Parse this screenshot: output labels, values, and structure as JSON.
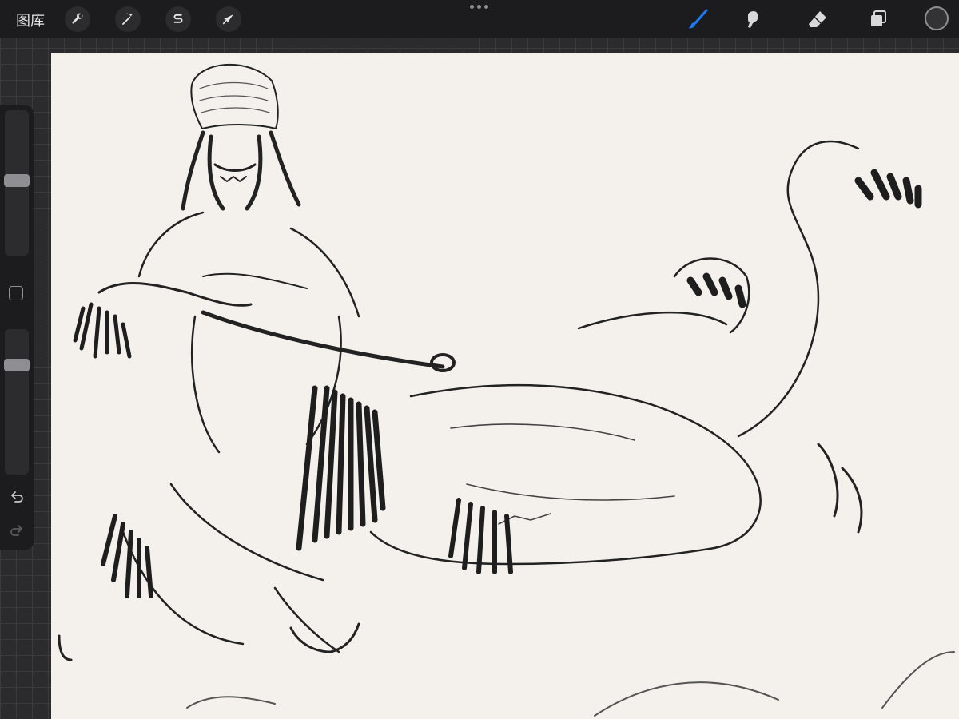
{
  "topbar": {
    "gallery_label": "图库",
    "left_tools": [
      {
        "icon": "wrench-icon",
        "label": "actions"
      },
      {
        "icon": "magic-wand-icon",
        "label": "adjustments"
      },
      {
        "icon": "selection-s-icon",
        "label": "selection"
      },
      {
        "icon": "arrow-cursor-icon",
        "label": "transform"
      }
    ],
    "right_tools": [
      {
        "icon": "brush-icon",
        "active": true
      },
      {
        "icon": "smudge-icon",
        "active": false
      },
      {
        "icon": "eraser-icon",
        "active": false
      },
      {
        "icon": "layers-icon",
        "active": false
      }
    ],
    "active_color": "#1a7cf5",
    "current_color": "#333335"
  },
  "sidebar": {
    "brush_size_level": 0.52,
    "opacity_level": 0.78,
    "icons": [
      "modify-square-icon",
      "undo-icon",
      "redo-icon"
    ]
  },
  "canvas": {
    "background": "#f4f1ec",
    "content": "sketch"
  }
}
